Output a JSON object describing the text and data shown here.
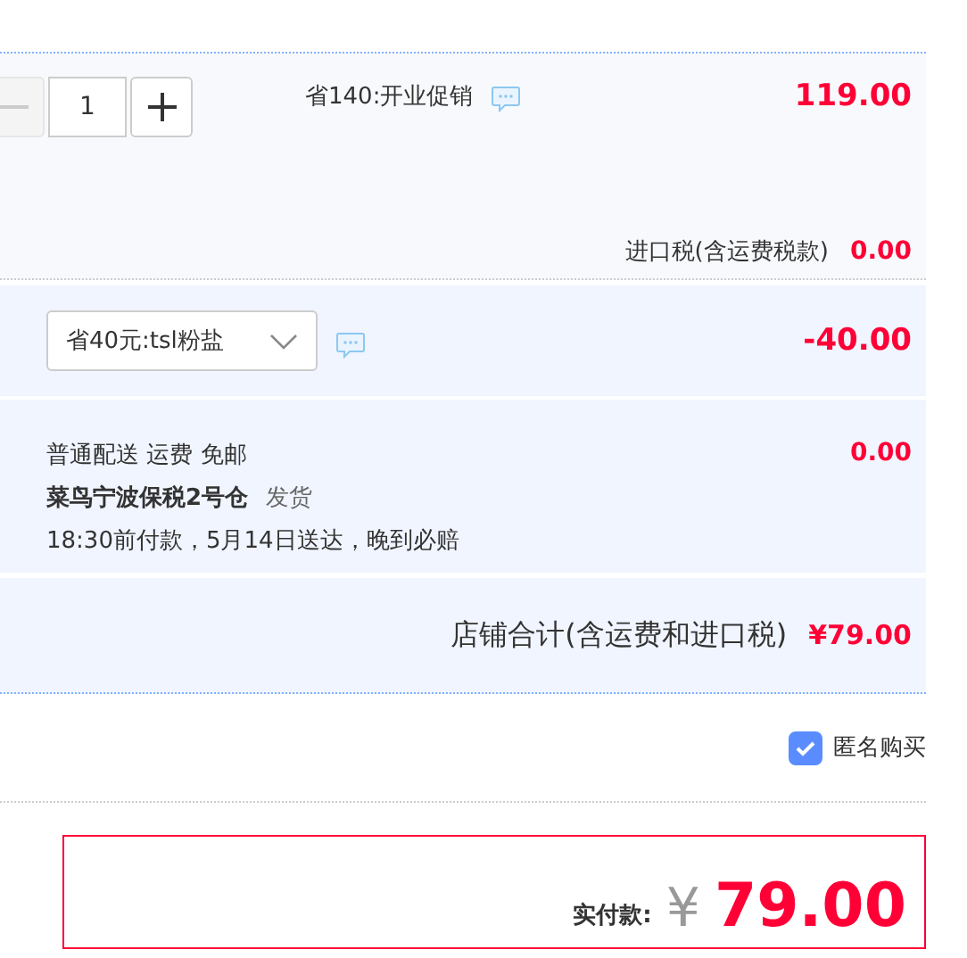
{
  "item": {
    "quantity": "1",
    "minus_disabled": true,
    "promotion": "省140:开业促销",
    "price": "119.00",
    "tax_label": "进口税(含运费税款)",
    "tax": "0.00"
  },
  "coupon": {
    "value": "省40元:tsl粉盐",
    "amount": "-40.00"
  },
  "shipping": {
    "method": "普通配送 运费 免邮",
    "warehouse": "菜鸟宁波保税2号仓",
    "dispatch": "发货",
    "promise": "18:30前付款，5月14日送达，晚到必赔",
    "fee": "0.00"
  },
  "store_total": {
    "label": "店铺合计(含运费和进口税)",
    "amount": "¥79.00"
  },
  "anonymous": {
    "label": "匿名购买",
    "checked": true
  },
  "payment": {
    "label": "实付款:",
    "currency": "¥",
    "amount": "79.00"
  }
}
